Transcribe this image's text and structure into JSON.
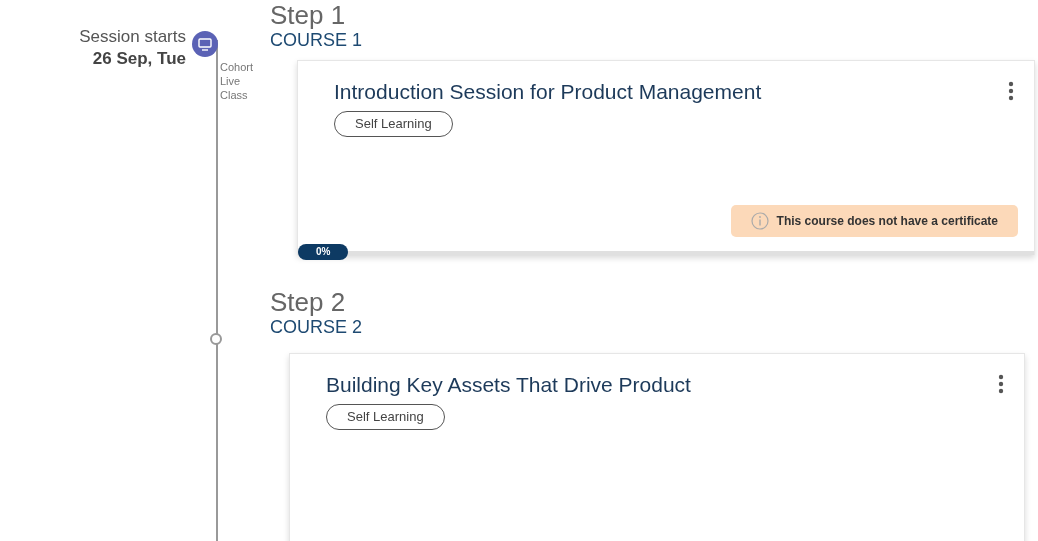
{
  "session": {
    "label": "Session starts",
    "date": "26 Sep, Tue",
    "type_label": "Cohort Live Class"
  },
  "steps": [
    {
      "step": "Step 1",
      "course": "COURSE 1",
      "title": "Introduction Session for Product Management",
      "tag": "Self Learning",
      "notice": "This course does not have a certificate",
      "progress": {
        "level": 0,
        "label": "0%"
      }
    },
    {
      "step": "Step 2",
      "course": "COURSE 2",
      "title": "Building Key Assets That Drive Product",
      "tag": "Self Learning"
    }
  ]
}
